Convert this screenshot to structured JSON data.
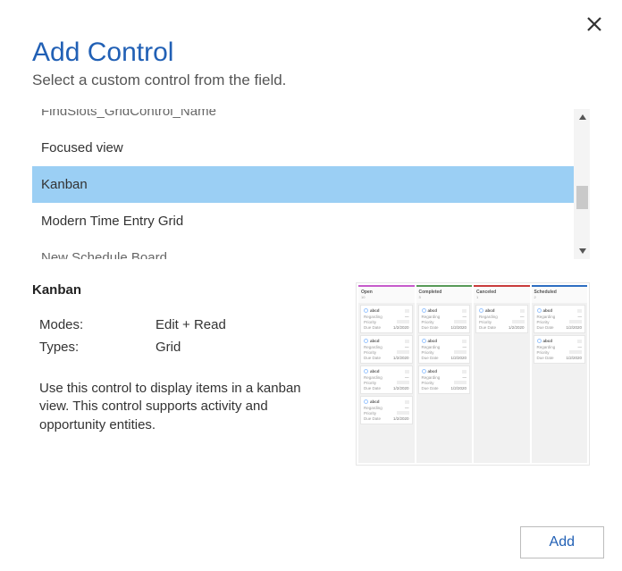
{
  "dialog": {
    "title": "Add Control",
    "subtitle": "Select a custom control from the field.",
    "close_label": "Close"
  },
  "list": {
    "items": [
      {
        "label": "FindSlots_GridControl_Name",
        "cutoff": "top"
      },
      {
        "label": "Focused view"
      },
      {
        "label": "Kanban",
        "selected": true
      },
      {
        "label": "Modern Time Entry Grid"
      },
      {
        "label": "New Schedule Board",
        "cutoff": "bottom"
      }
    ]
  },
  "details": {
    "title": "Kanban",
    "modes_label": "Modes:",
    "modes_value": "Edit + Read",
    "types_label": "Types:",
    "types_value": "Grid",
    "description": "Use this control to display items in a kanban view. This control supports activity and opportunity entities."
  },
  "preview": {
    "columns": [
      {
        "title": "Open",
        "count": "10",
        "cards": 4
      },
      {
        "title": "Completed",
        "count": "3",
        "cards": 3
      },
      {
        "title": "Canceled",
        "count": "1",
        "cards": 1
      },
      {
        "title": "Scheduled",
        "count": "2",
        "cards": 2
      }
    ]
  },
  "footer": {
    "add_label": "Add"
  }
}
